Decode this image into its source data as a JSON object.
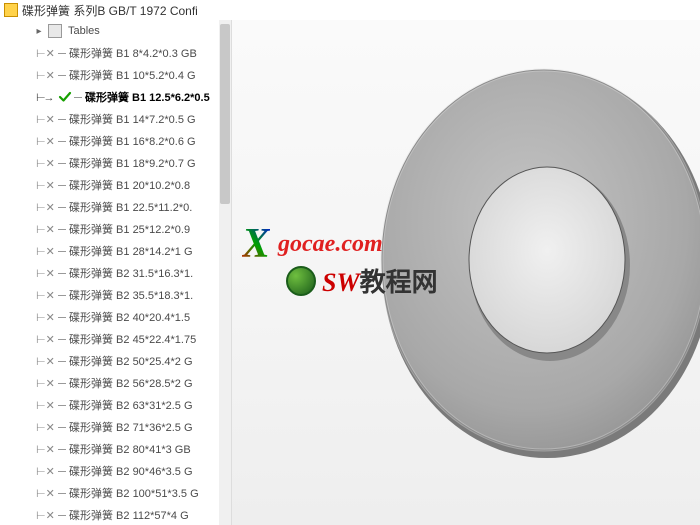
{
  "header": {
    "title": "碟形弹簧 系列B GB/T 1972 Confi"
  },
  "tree": {
    "tables_label": "Tables",
    "configs": [
      {
        "label": "碟形弹簧 B1 8*4.2*0.3 GB",
        "active": false
      },
      {
        "label": "碟形弹簧 B1 10*5.2*0.4 G",
        "active": false
      },
      {
        "label": "碟形弹簧 B1 12.5*6.2*0.5",
        "active": true
      },
      {
        "label": "碟形弹簧 B1 14*7.2*0.5 G",
        "active": false
      },
      {
        "label": "碟形弹簧 B1 16*8.2*0.6 G",
        "active": false
      },
      {
        "label": "碟形弹簧 B1 18*9.2*0.7 G",
        "active": false
      },
      {
        "label": "碟形弹簧 B1 20*10.2*0.8",
        "active": false
      },
      {
        "label": "碟形弹簧 B1 22.5*11.2*0.",
        "active": false
      },
      {
        "label": "碟形弹簧 B1 25*12.2*0.9",
        "active": false
      },
      {
        "label": "碟形弹簧 B1 28*14.2*1 G",
        "active": false
      },
      {
        "label": "碟形弹簧 B2 31.5*16.3*1.",
        "active": false
      },
      {
        "label": "碟形弹簧 B2 35.5*18.3*1.",
        "active": false
      },
      {
        "label": "碟形弹簧 B2 40*20.4*1.5",
        "active": false
      },
      {
        "label": "碟形弹簧 B2 45*22.4*1.75",
        "active": false
      },
      {
        "label": "碟形弹簧 B2 50*25.4*2 G",
        "active": false
      },
      {
        "label": "碟形弹簧 B2 56*28.5*2 G",
        "active": false
      },
      {
        "label": "碟形弹簧 B2 63*31*2.5 G",
        "active": false
      },
      {
        "label": "碟形弹簧 B2 71*36*2.5 G",
        "active": false
      },
      {
        "label": "碟形弹簧 B2 80*41*3 GB",
        "active": false
      },
      {
        "label": "碟形弹簧 B2 90*46*3.5 G",
        "active": false
      },
      {
        "label": "碟形弹簧 B2 100*51*3.5 G",
        "active": false
      },
      {
        "label": "碟形弹簧 B2 112*57*4 G",
        "active": false
      }
    ]
  },
  "watermark": {
    "url": "gocae.com",
    "sw_prefix": "SW",
    "sw_text": "教程网"
  },
  "colors": {
    "active_check": "#16a000",
    "text_muted": "#4a4a4a"
  }
}
